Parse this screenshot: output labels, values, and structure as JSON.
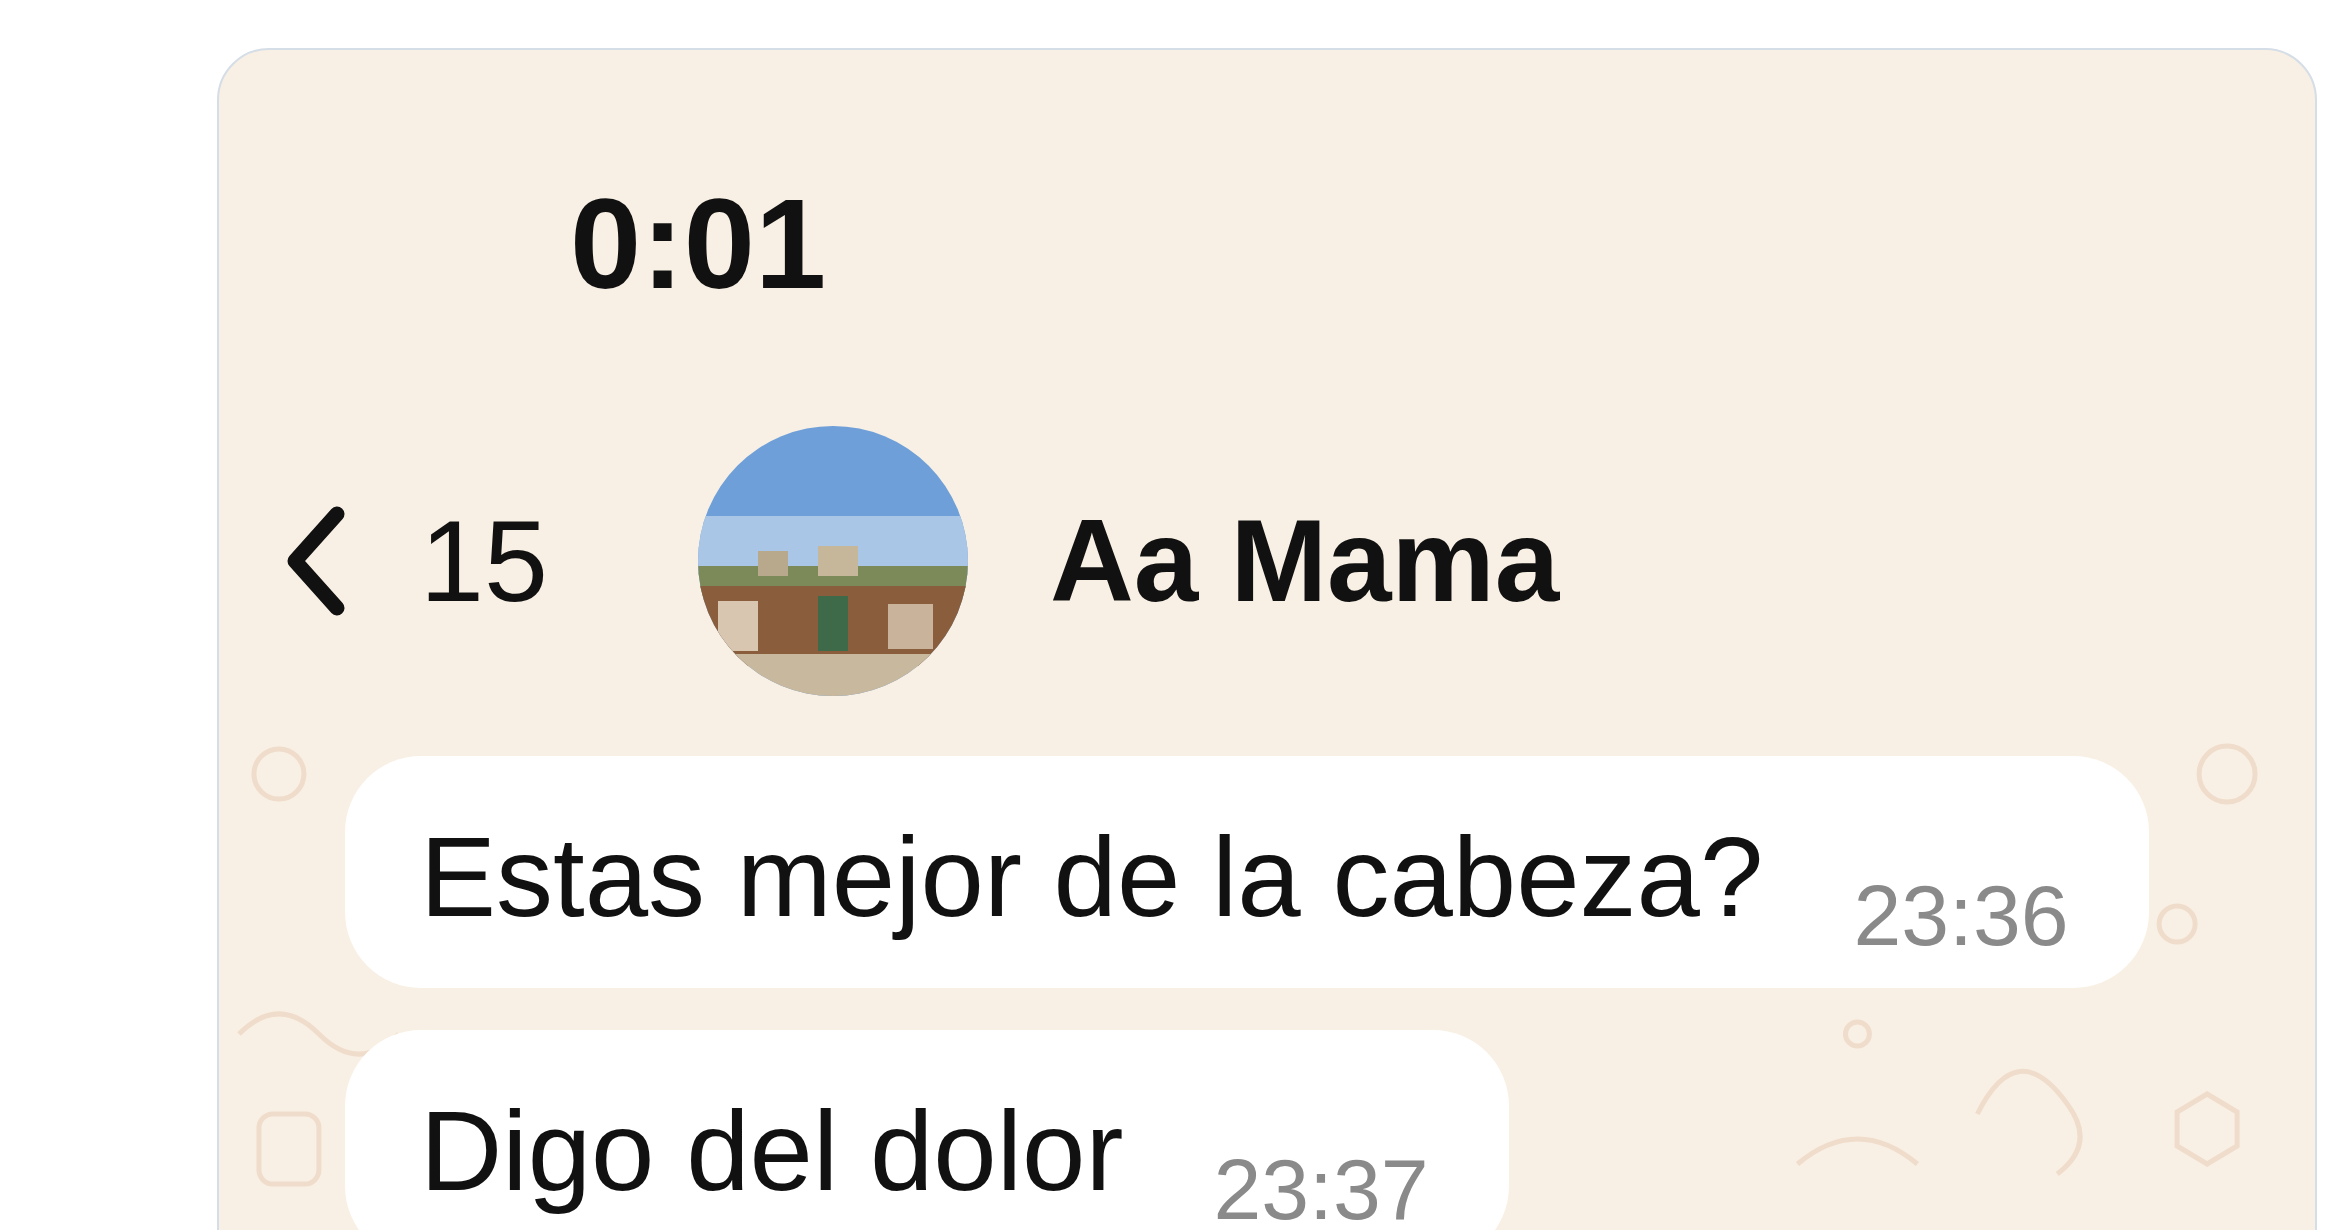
{
  "status_bar": {
    "time": "0:01"
  },
  "header": {
    "back_count": "15",
    "contact_name": "Aa Mama"
  },
  "messages": [
    {
      "outgoing": false,
      "text": "Estas mejor de la cabeza?",
      "time": "23:36"
    },
    {
      "outgoing": false,
      "text": "Digo del dolor",
      "time": "23:37"
    }
  ]
}
